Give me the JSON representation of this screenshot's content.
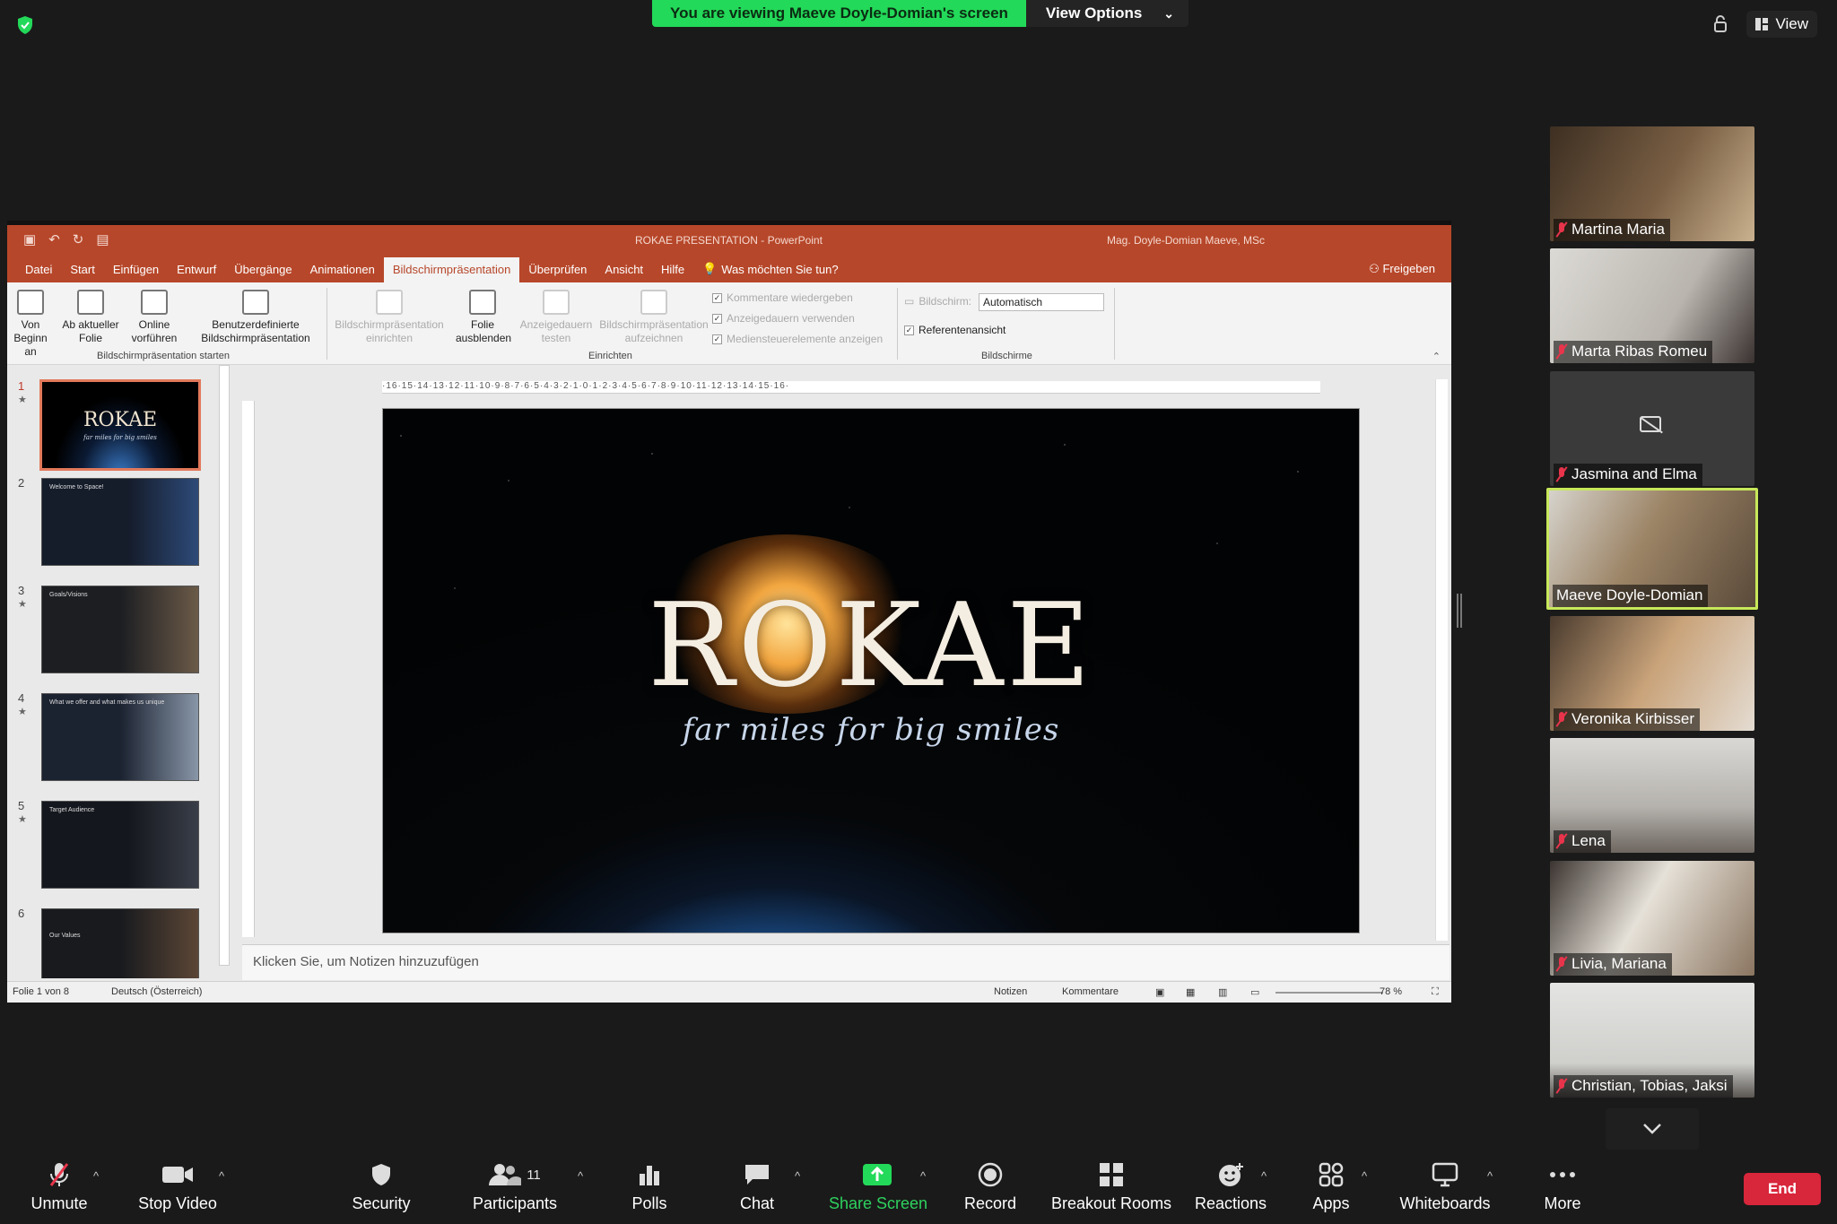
{
  "banner": {
    "message": "You are viewing Maeve Doyle-Domian's screen",
    "view_options": "View Options"
  },
  "top_right": {
    "view_label": "View"
  },
  "powerpoint": {
    "title": "ROKAE PRESENTATION  -  PowerPoint",
    "user": "Mag. Doyle-Domian Maeve, MSc",
    "tabs": [
      "Datei",
      "Start",
      "Einfügen",
      "Entwurf",
      "Übergänge",
      "Animationen",
      "Bildschirmpräsentation",
      "Überprüfen",
      "Ansicht",
      "Hilfe"
    ],
    "active_tab": "Bildschirmpräsentation",
    "tell_me": "Was möchten Sie tun?",
    "share": "Freigeben",
    "ribbon": {
      "von_beginn": [
        "Von",
        "Beginn an"
      ],
      "ab_aktueller": [
        "Ab aktueller",
        "Folie"
      ],
      "online": [
        "Online",
        "vorführen"
      ],
      "benutzer": [
        "Benutzerdefinierte",
        "Bildschirmpräsentation"
      ],
      "group1": "Bildschirmpräsentation starten",
      "einrichten": [
        "Bildschirmpräsentation",
        "einrichten"
      ],
      "folie_ausblenden": [
        "Folie",
        "ausblenden"
      ],
      "anzeige_testen": [
        "Anzeigedauern",
        "testen"
      ],
      "aufzeichnen": [
        "Bildschirmpräsentation",
        "aufzeichnen"
      ],
      "chk_kommentare": "Kommentare wiedergeben",
      "chk_anzeige": "Anzeigedauern verwenden",
      "chk_medien": "Mediensteuerelemente anzeigen",
      "group2": "Einrichten",
      "bildschirm_label": "Bildschirm:",
      "bildschirm_value": "Automatisch",
      "referent": "Referentenansicht",
      "group3": "Bildschirme"
    },
    "ruler": "·16·15·14·13·12·11·10·9·8·7·6·5·4·3·2·1·0·1·2·3·4·5·6·7·8·9·10·11·12·13·14·15·16·",
    "slides": [
      {
        "num": "1",
        "title": "ROKAE",
        "sub": "far miles for big smiles"
      },
      {
        "num": "2",
        "title": "Welcome to Space!"
      },
      {
        "num": "3",
        "title": "Goals/Visions"
      },
      {
        "num": "4",
        "title": "What we offer and what makes us unique"
      },
      {
        "num": "5",
        "title": "Target Audience"
      },
      {
        "num": "6",
        "title": "Our Values"
      }
    ],
    "main_slide": {
      "title": "ROKAE",
      "subtitle": "far miles for big smiles"
    },
    "notes_placeholder": "Klicken Sie, um Notizen hinzuzufügen",
    "status": {
      "slide": "Folie 1 von 8",
      "language": "Deutsch (Österreich)",
      "notes": "Notizen",
      "comments": "Kommentare",
      "zoom": "78 %"
    }
  },
  "participants": [
    {
      "name": "Martina Maria",
      "bg": "#5a4634"
    },
    {
      "name": "Marta Ribas Romeu",
      "bg": "#c9c6c0"
    },
    {
      "name": "Jasmina and Elma",
      "bg": "#3c3c3c",
      "camera_off": true
    },
    {
      "name": "Maeve Doyle-Domian",
      "bg": "#a88f6f",
      "speaking": true
    },
    {
      "name": "Veronika Kirbisser",
      "bg": "#8b7f73"
    },
    {
      "name": "Lena",
      "bg": "#bfbdb9"
    },
    {
      "name": "Livia, Mariana",
      "bg": "#7d756c"
    },
    {
      "name": "Christian, Tobias, Jaksi",
      "bg": "#d4d4d2"
    }
  ],
  "toolbar": {
    "unmute": "Unmute",
    "stop_video": "Stop Video",
    "security": "Security",
    "participants": "Participants",
    "participants_count": "11",
    "polls": "Polls",
    "chat": "Chat",
    "share_screen": "Share Screen",
    "record": "Record",
    "breakout": "Breakout Rooms",
    "reactions": "Reactions",
    "apps": "Apps",
    "whiteboards": "Whiteboards",
    "more": "More",
    "end": "End"
  },
  "colors": {
    "ppt_accent": "#b7472a",
    "zoom_green": "#23d959",
    "end_red": "#d8263b",
    "speaker_border": "#c7e85a"
  }
}
